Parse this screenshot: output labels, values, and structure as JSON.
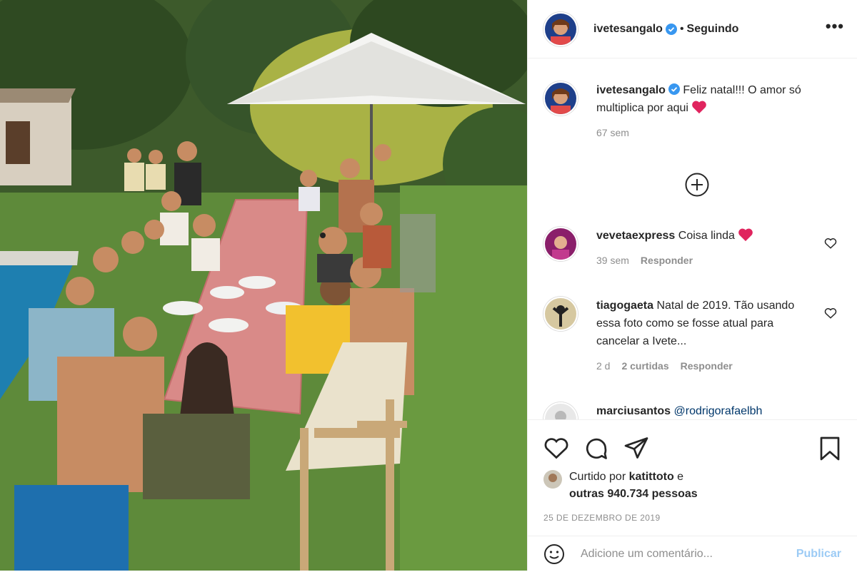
{
  "header": {
    "username": "ivetesangalo",
    "dot": "•",
    "following": "Seguindo",
    "more": "•••"
  },
  "caption": {
    "username": "ivetesangalo",
    "text": "Feliz natal!!! O amor só multiplica por aqui",
    "time": "67 sem"
  },
  "comments": [
    {
      "username": "vevetaexpress",
      "text": "Coisa linda",
      "time": "39 sem",
      "likes": "",
      "reply": "Responder"
    },
    {
      "username": "tiagogaeta",
      "text": "Natal de 2019. Tão usando essa foto como se fosse atual para cancelar a Ivete...",
      "time": "2 d",
      "likes": "2 curtidas",
      "reply": "Responder"
    },
    {
      "username": "marciusantos",
      "text": "@rodrigorafaelbh"
    }
  ],
  "likes": {
    "prefix": "Curtido por",
    "user": "katittoto",
    "and": "e",
    "others": "outras 940.734 pessoas"
  },
  "date": "25 DE DEZEMBRO DE 2019",
  "add_comment": {
    "placeholder": "Adicione um comentário...",
    "publish": "Publicar"
  },
  "colors": {
    "verified": "#3897f0",
    "heart": "#e0245e",
    "publish": "#9ccbf5"
  },
  "icons": [
    "heart-icon",
    "comment-icon",
    "share-icon",
    "bookmark-icon",
    "emoji-icon",
    "add-comment-icon",
    "more-icon",
    "verified-icon"
  ]
}
